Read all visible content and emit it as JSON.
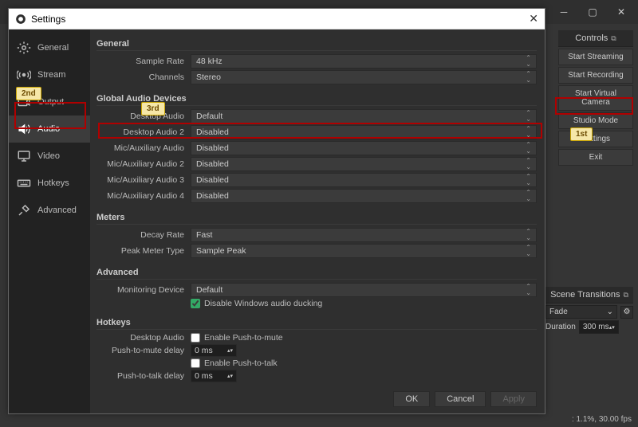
{
  "main_window": {
    "controls_title": "Controls",
    "buttons": {
      "start_streaming": "Start Streaming",
      "start_recording": "Start Recording",
      "start_virtual_camera": "Start Virtual Camera",
      "studio_mode": "Studio Mode",
      "settings": "Settings",
      "exit": "Exit"
    },
    "scene_transitions": {
      "title": "Scene Transitions",
      "selected": "Fade",
      "duration_label": "Duration",
      "duration_value": "300 ms"
    },
    "status": ": 1.1%, 30.00 fps"
  },
  "dialog": {
    "title": "Settings",
    "sidebar": {
      "general": "General",
      "stream": "Stream",
      "output": "Output",
      "audio": "Audio",
      "video": "Video",
      "hotkeys": "Hotkeys",
      "advanced": "Advanced"
    },
    "sections": {
      "general": {
        "title": "General",
        "sample_rate_label": "Sample Rate",
        "sample_rate_value": "48 kHz",
        "channels_label": "Channels",
        "channels_value": "Stereo"
      },
      "global_audio": {
        "title": "Global Audio Devices",
        "rows": [
          {
            "label": "Desktop Audio",
            "value": "Default"
          },
          {
            "label": "Desktop Audio 2",
            "value": "Disabled"
          },
          {
            "label": "Mic/Auxiliary Audio",
            "value": "Disabled"
          },
          {
            "label": "Mic/Auxiliary Audio 2",
            "value": "Disabled"
          },
          {
            "label": "Mic/Auxiliary Audio 3",
            "value": "Disabled"
          },
          {
            "label": "Mic/Auxiliary Audio 4",
            "value": "Disabled"
          }
        ]
      },
      "meters": {
        "title": "Meters",
        "decay_label": "Decay Rate",
        "decay_value": "Fast",
        "peak_label": "Peak Meter Type",
        "peak_value": "Sample Peak"
      },
      "advanced": {
        "title": "Advanced",
        "monitoring_label": "Monitoring Device",
        "monitoring_value": "Default",
        "ducking": "Disable Windows audio ducking"
      },
      "hotkeys": {
        "title": "Hotkeys",
        "desktop_audio_label": "Desktop Audio",
        "enable_ptm": "Enable Push-to-mute",
        "ptm_delay_label": "Push-to-mute delay",
        "ptm_delay_value": "0 ms",
        "enable_ptt": "Enable Push-to-talk",
        "ptt_delay_label": "Push-to-talk delay",
        "ptt_delay_value": "0 ms"
      }
    },
    "buttons": {
      "ok": "OK",
      "cancel": "Cancel",
      "apply": "Apply"
    }
  },
  "annotations": {
    "first": "1st",
    "second": "2nd",
    "third": "3rd"
  }
}
